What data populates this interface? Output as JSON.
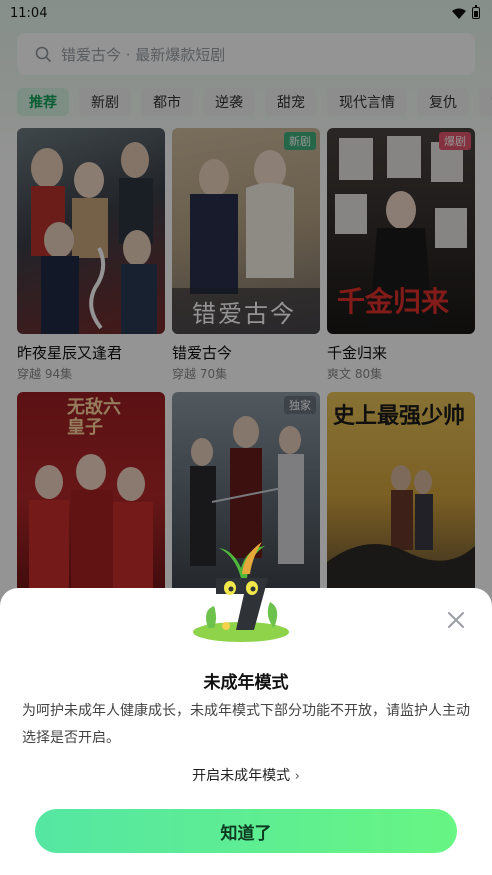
{
  "status_bar": {
    "time": "11:04"
  },
  "search": {
    "placeholder": "错爱古今 · 最新爆款短剧"
  },
  "tabs": [
    "推荐",
    "新剧",
    "都市",
    "逆袭",
    "甜宠",
    "现代言情",
    "复仇",
    "古"
  ],
  "dramas": [
    {
      "title": "昨夜星辰又逢君",
      "meta": "穿越 94集",
      "badge": ""
    },
    {
      "title": "错爱古今",
      "meta": "穿越 70集",
      "badge": "新剧"
    },
    {
      "title": "千金归来",
      "meta": "爽文 80集",
      "badge": "爆剧"
    },
    {
      "title": "",
      "meta": "",
      "badge": ""
    },
    {
      "title": "",
      "meta": "",
      "badge": "独家"
    },
    {
      "title": "",
      "meta": "",
      "badge": ""
    }
  ],
  "poster_text": {
    "p2": "错爱古今",
    "p3": "千金归来",
    "p4": "无敌六皇子",
    "p6": "史上最强少帅"
  },
  "modal": {
    "title": "未成年模式",
    "description": "为呵护未成年人健康成长，未成年模式下部分功能不开放，请监护人主动选择是否开启。",
    "enable_link": "开启未成年模式",
    "confirm_button": "知道了"
  },
  "colors": {
    "accent": "#14a35a",
    "button_start": "#55e6a3",
    "button_end": "#67f583"
  }
}
